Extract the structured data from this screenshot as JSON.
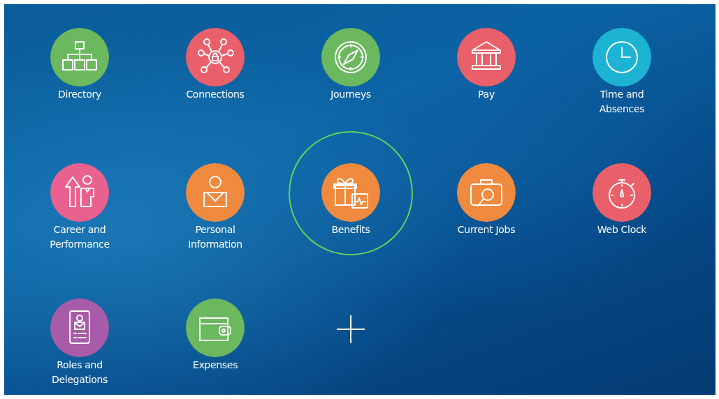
{
  "tiles": [
    {
      "label": "Directory",
      "kind": "org-chart",
      "color": "#6cb85f",
      "selected": false
    },
    {
      "label": "Connections",
      "kind": "network",
      "color": "#e9606a",
      "selected": false
    },
    {
      "label": "Journeys",
      "kind": "compass",
      "color": "#6cb85f",
      "selected": false
    },
    {
      "label": "Pay",
      "kind": "bank",
      "color": "#e9606a",
      "selected": false
    },
    {
      "label": "Time and Absences",
      "kind": "clock",
      "color": "#1db4d4",
      "selected": false
    },
    {
      "label": "Career and Performance",
      "kind": "career",
      "color": "#e9618f",
      "selected": false
    },
    {
      "label": "Personal Information",
      "kind": "person",
      "color": "#ef8a3e",
      "selected": false
    },
    {
      "label": "Benefits",
      "kind": "gift",
      "color": "#ef8a3e",
      "selected": true
    },
    {
      "label": "Current Jobs",
      "kind": "job-search",
      "color": "#ef8a3e",
      "selected": false
    },
    {
      "label": "Web Clock",
      "kind": "stopwatch",
      "color": "#e9606a",
      "selected": false
    },
    {
      "label": "Roles and Delegations",
      "kind": "id-badge",
      "color": "#a85ba8",
      "selected": false
    },
    {
      "label": "Expenses",
      "kind": "wallet",
      "color": "#6cb85f",
      "selected": false
    }
  ],
  "add_tile": {
    "kind": "plus"
  }
}
